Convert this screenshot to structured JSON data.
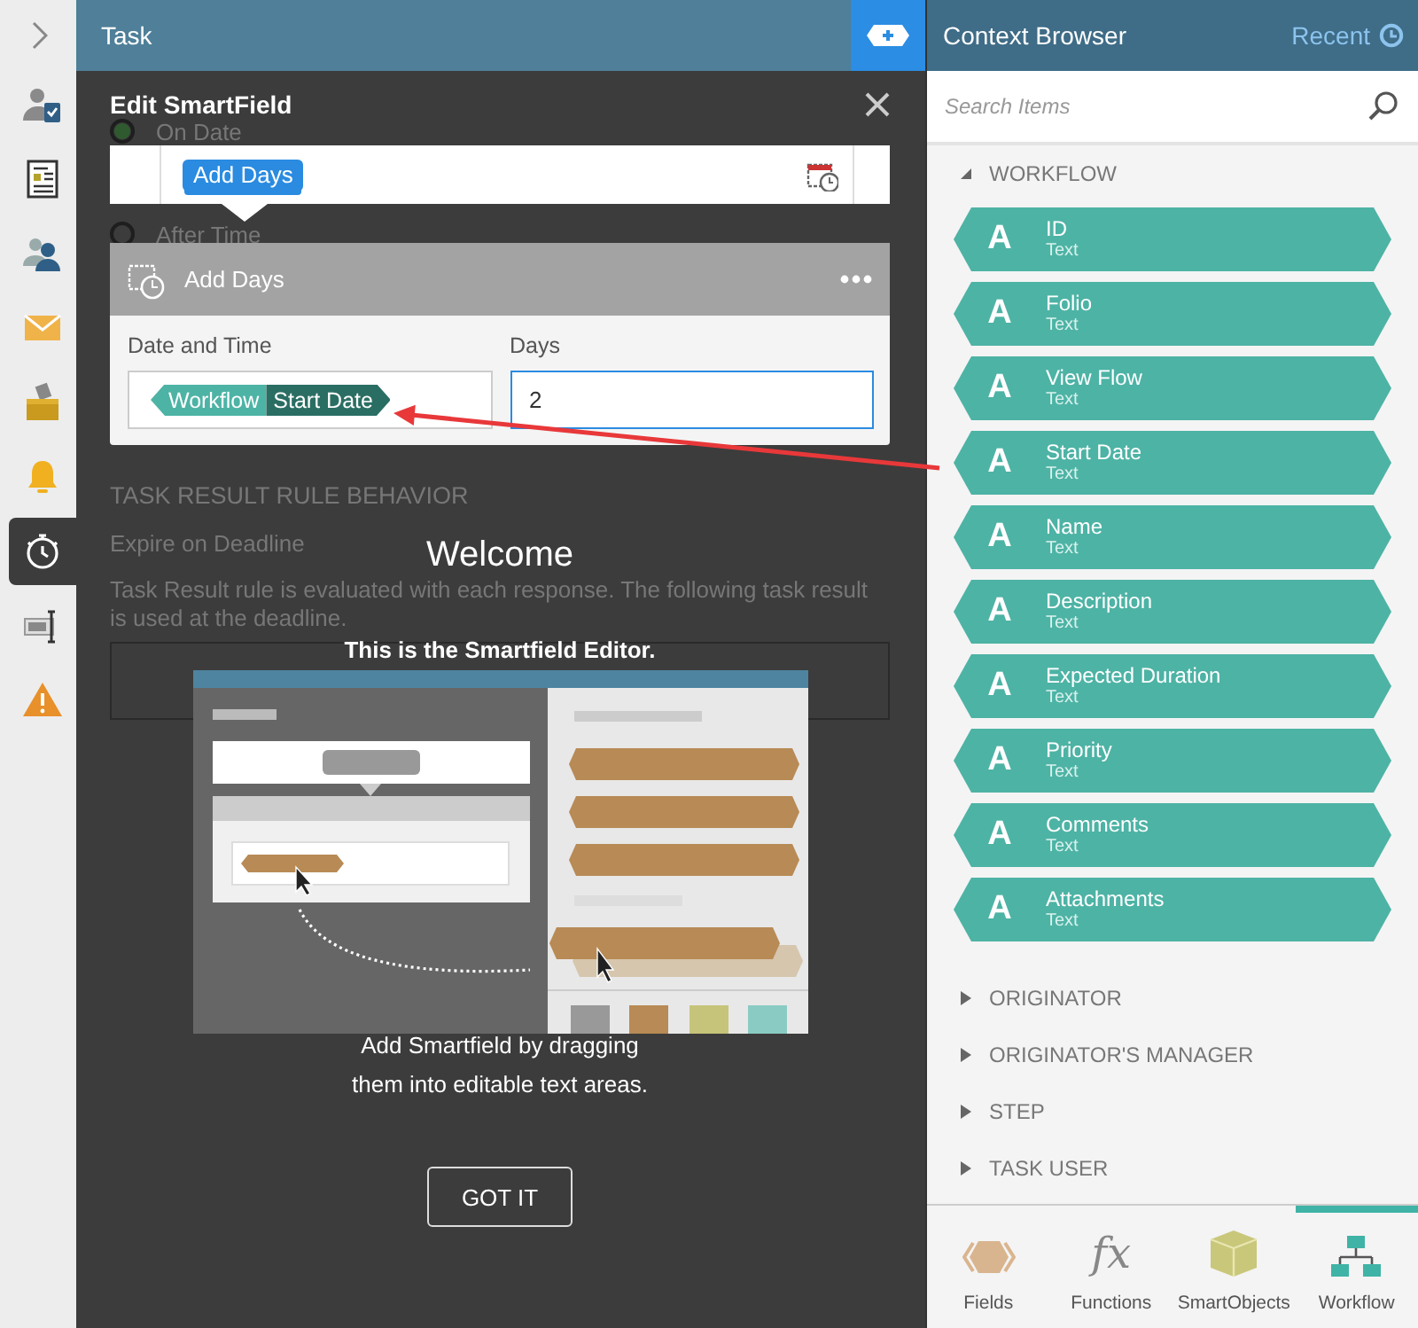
{
  "rail": {
    "items": [
      {
        "kind": "user-task",
        "selected": false
      },
      {
        "kind": "form",
        "selected": false
      },
      {
        "kind": "users",
        "selected": false
      },
      {
        "kind": "mail",
        "selected": false
      },
      {
        "kind": "inbox",
        "selected": false
      },
      {
        "kind": "bell",
        "selected": false
      },
      {
        "kind": "stopwatch",
        "selected": true
      },
      {
        "kind": "textbox",
        "selected": false
      },
      {
        "kind": "warning",
        "selected": false
      }
    ]
  },
  "task": {
    "title": "Task",
    "options": [
      {
        "label": "On Date",
        "selected": true
      },
      {
        "label": "After Time",
        "selected": false
      }
    ],
    "section_heading": "TASK RESULT RULE BEHAVIOR",
    "subheading": "Expire on Deadline",
    "description": "Task Result rule is evaluated with each response. The following task result is used at the deadline."
  },
  "edit_smartfield": {
    "title": "Edit SmartField",
    "chip": "Add Days",
    "function": {
      "title": "Add Days",
      "params": [
        {
          "kind": "token",
          "label": "Date and Time",
          "context": "Workflow",
          "name": "Start Date"
        },
        {
          "kind": "input",
          "label": "Days",
          "value": "2"
        }
      ]
    }
  },
  "welcome": {
    "title": "Welcome",
    "subtitle": "This is the Smartfield Editor.",
    "text": "Add Smartfield by dragging them into editable text areas.",
    "button": "GOT IT"
  },
  "context_browser": {
    "title": "Context Browser",
    "recent": "Recent",
    "search": {
      "placeholder": "Search Items"
    },
    "groups": [
      {
        "label": "WORKFLOW",
        "expanded": true,
        "items": [
          {
            "glyph": "A",
            "name": "ID",
            "type": "Text"
          },
          {
            "glyph": "A",
            "name": "Folio",
            "type": "Text"
          },
          {
            "glyph": "A",
            "name": "View Flow",
            "type": "Text"
          },
          {
            "glyph": "A",
            "name": "Start Date",
            "type": "Text"
          },
          {
            "glyph": "A",
            "name": "Name",
            "type": "Text"
          },
          {
            "glyph": "A",
            "name": "Description",
            "type": "Text"
          },
          {
            "glyph": "A",
            "name": "Expected Duration",
            "type": "Text"
          },
          {
            "glyph": "A",
            "name": "Priority",
            "type": "Text"
          },
          {
            "glyph": "A",
            "name": "Comments",
            "type": "Text"
          },
          {
            "glyph": "A",
            "name": "Attachments",
            "type": "Text"
          }
        ]
      },
      {
        "label": "ORIGINATOR",
        "expanded": false
      },
      {
        "label": "ORIGINATOR'S MANAGER",
        "expanded": false
      },
      {
        "label": "STEP",
        "expanded": false
      },
      {
        "label": "TASK USER",
        "expanded": false
      }
    ],
    "tabs": [
      {
        "kind": "fields",
        "label": "Fields",
        "selected": false
      },
      {
        "kind": "functions",
        "label": "Functions",
        "glyph": "fx",
        "selected": false
      },
      {
        "kind": "smartobjects",
        "label": "SmartObjects",
        "selected": false
      },
      {
        "kind": "workflow",
        "label": "Workflow",
        "selected": true
      }
    ]
  }
}
